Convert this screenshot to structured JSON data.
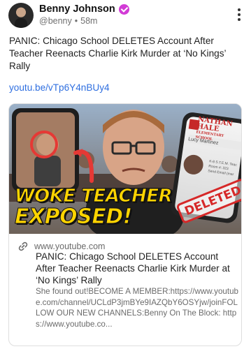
{
  "author": {
    "name": "Benny Johnson",
    "handle": "@benny",
    "separator": "•",
    "time": "58m",
    "verified_icon": "verified-badge-icon",
    "verified_color": "#d23bd6"
  },
  "post": {
    "text": "PANIC: Chicago School DELETES Account After Teacher Reenacts Charlie Kirk Murder at ‘No Kings’ Rally",
    "link": "youtu.be/vTp6Y4nBUy4",
    "link_color": "#2f6fe0"
  },
  "card": {
    "thumbnail": {
      "headline_line1": "WOKE TEACHER",
      "headline_line2": "EXPOSED!",
      "stamp": "DELETED",
      "school_line1": "NATHAN HALE",
      "school_line2": "ELEMENTARY SCHOOL",
      "teacher_name": "Lucy Martinez",
      "phone_info1": "K-8 S.T.E.M. Teac",
      "phone_info2": "Room #: 323",
      "phone_info3": "Send Email (mar",
      "accent_yellow": "#ffd400",
      "stamp_red": "#d62828"
    },
    "domain": "www.youtube.com",
    "title": "PANIC: Chicago School DELETES Account After Teacher Reenacts Charlie Kirk Murder at ‘No Kings’ Rally",
    "description": "She found out!BECOME A MEMBER:https://www.youtube.com/channel/UCLdP3jmBYe9IAZQbY6OSYjw/joinFOLLOW OUR NEW CHANNELS:Benny On The Block: https://www.youtube.co..."
  }
}
